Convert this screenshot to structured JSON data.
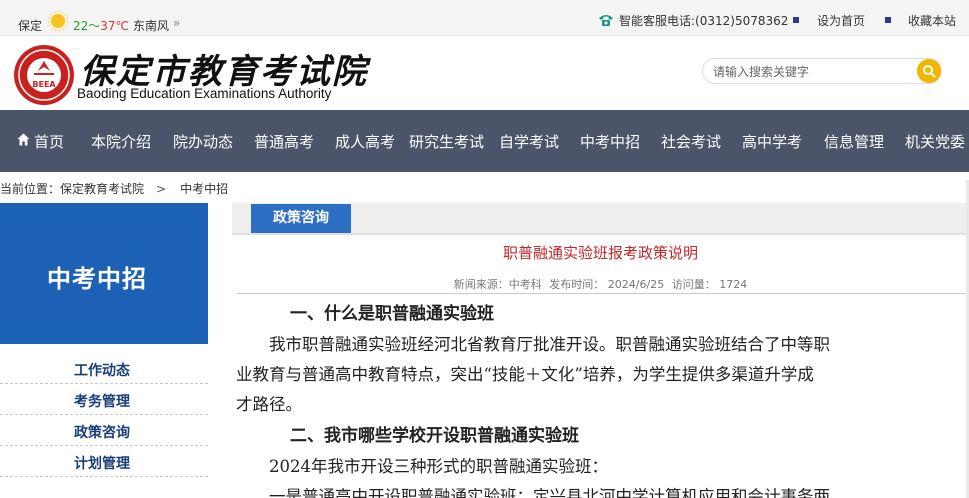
{
  "topbar": {
    "city": "保定",
    "temp_low": "22～",
    "temp_high": "37℃",
    "wind": "东南风",
    "more": "»",
    "phone_label": "智能客服电话:(0312)5078362",
    "set_home": "设为首页",
    "favorite": "收藏本站"
  },
  "header": {
    "logo_cn": "保定市教育考试院",
    "logo_en": "Baoding Education Examinations Authority",
    "seal_text": "BEEA",
    "search_placeholder": "请输入搜索关键字"
  },
  "nav": {
    "items": [
      "首页",
      "本院介绍",
      "院办动态",
      "普通高考",
      "成人高考",
      "研究生考试",
      "自学考试",
      "中考中招",
      "社会考试",
      "高中学考",
      "信息管理",
      "机关党委"
    ]
  },
  "breadcrumb": {
    "label": "当前位置：保定教育考试院",
    "sep": ">",
    "current": "中考中招"
  },
  "sidebar": {
    "banner": "中考中招",
    "items": [
      "工作动态",
      "考务管理",
      "政策咨询",
      "计划管理"
    ]
  },
  "article": {
    "category_tab": "政策咨询",
    "title": "职普融通实验班报考政策说明",
    "meta_source": "新闻来源：中考科",
    "meta_date": "发布时间： 2024/6/25",
    "meta_views": "访问量： 1724",
    "h1": "一、什么是职普融通实验班",
    "p1_line1": "　　我市职普融通实验班经河北省教育厅批准开设。职普融通实验班结合了中等职",
    "p1_line2": "业教育与普通高中教育特点，突出“技能＋文化”培养，为学生提供多渠道升学成",
    "p1_line3": "才路径。",
    "h2": "二、我市哪些学校开设职普融通实验班",
    "p2_line1": "　　2024年我市开设三种形式的职普融通实验班：",
    "p2_line2": "　　一是普通高中开设职普融通实验班：定兴县北河中学计算机应用和会计事务两"
  },
  "colors": {
    "nav_bg": "#4b5569",
    "side_banner": "#1c61b5",
    "tab_blue": "#2d6fc4",
    "title_red": "#c0282b",
    "sidebar_link": "#1b3d7a",
    "search_btn": "#f2b600"
  }
}
